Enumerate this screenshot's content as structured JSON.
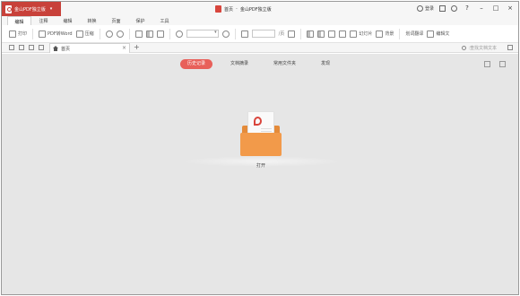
{
  "app": {
    "name": "金山PDF独立版",
    "window_title_page": "首页",
    "window_title_sep": "-",
    "window_title_app": "金山PDF独立版",
    "login_label": "登录"
  },
  "menu": {
    "tabs": [
      {
        "label": "编辑",
        "active": true
      },
      {
        "label": "注释"
      },
      {
        "label": "编辑"
      },
      {
        "label": "转换"
      },
      {
        "label": "页面"
      },
      {
        "label": "保护"
      },
      {
        "label": "工具"
      }
    ]
  },
  "toolbar": {
    "print_label": "打印",
    "pdf_to_word_label": "PDF转Word",
    "compress_label": "压缩",
    "page_total": "/页",
    "play_label": "幻灯片",
    "background_label": "背景",
    "translate_label": "划词翻译",
    "ocr_label": "编辑文"
  },
  "doc_tabs": {
    "home_tab_label": "首页",
    "close_symbol": "×",
    "new_tab_symbol": "+",
    "search_placeholder": ":查找文档文本"
  },
  "workspace": {
    "tabs": [
      {
        "label": "历史记录",
        "active": true
      },
      {
        "label": "文档摘录"
      },
      {
        "label": "常用文件夹"
      },
      {
        "label": "发现"
      }
    ],
    "open_label": "打开"
  },
  "colors": {
    "brand_red": "#c8413a",
    "active_pill": "#e8605a",
    "folder_orange": "#f29a4a",
    "workspace_bg": "#e6e6e6"
  }
}
